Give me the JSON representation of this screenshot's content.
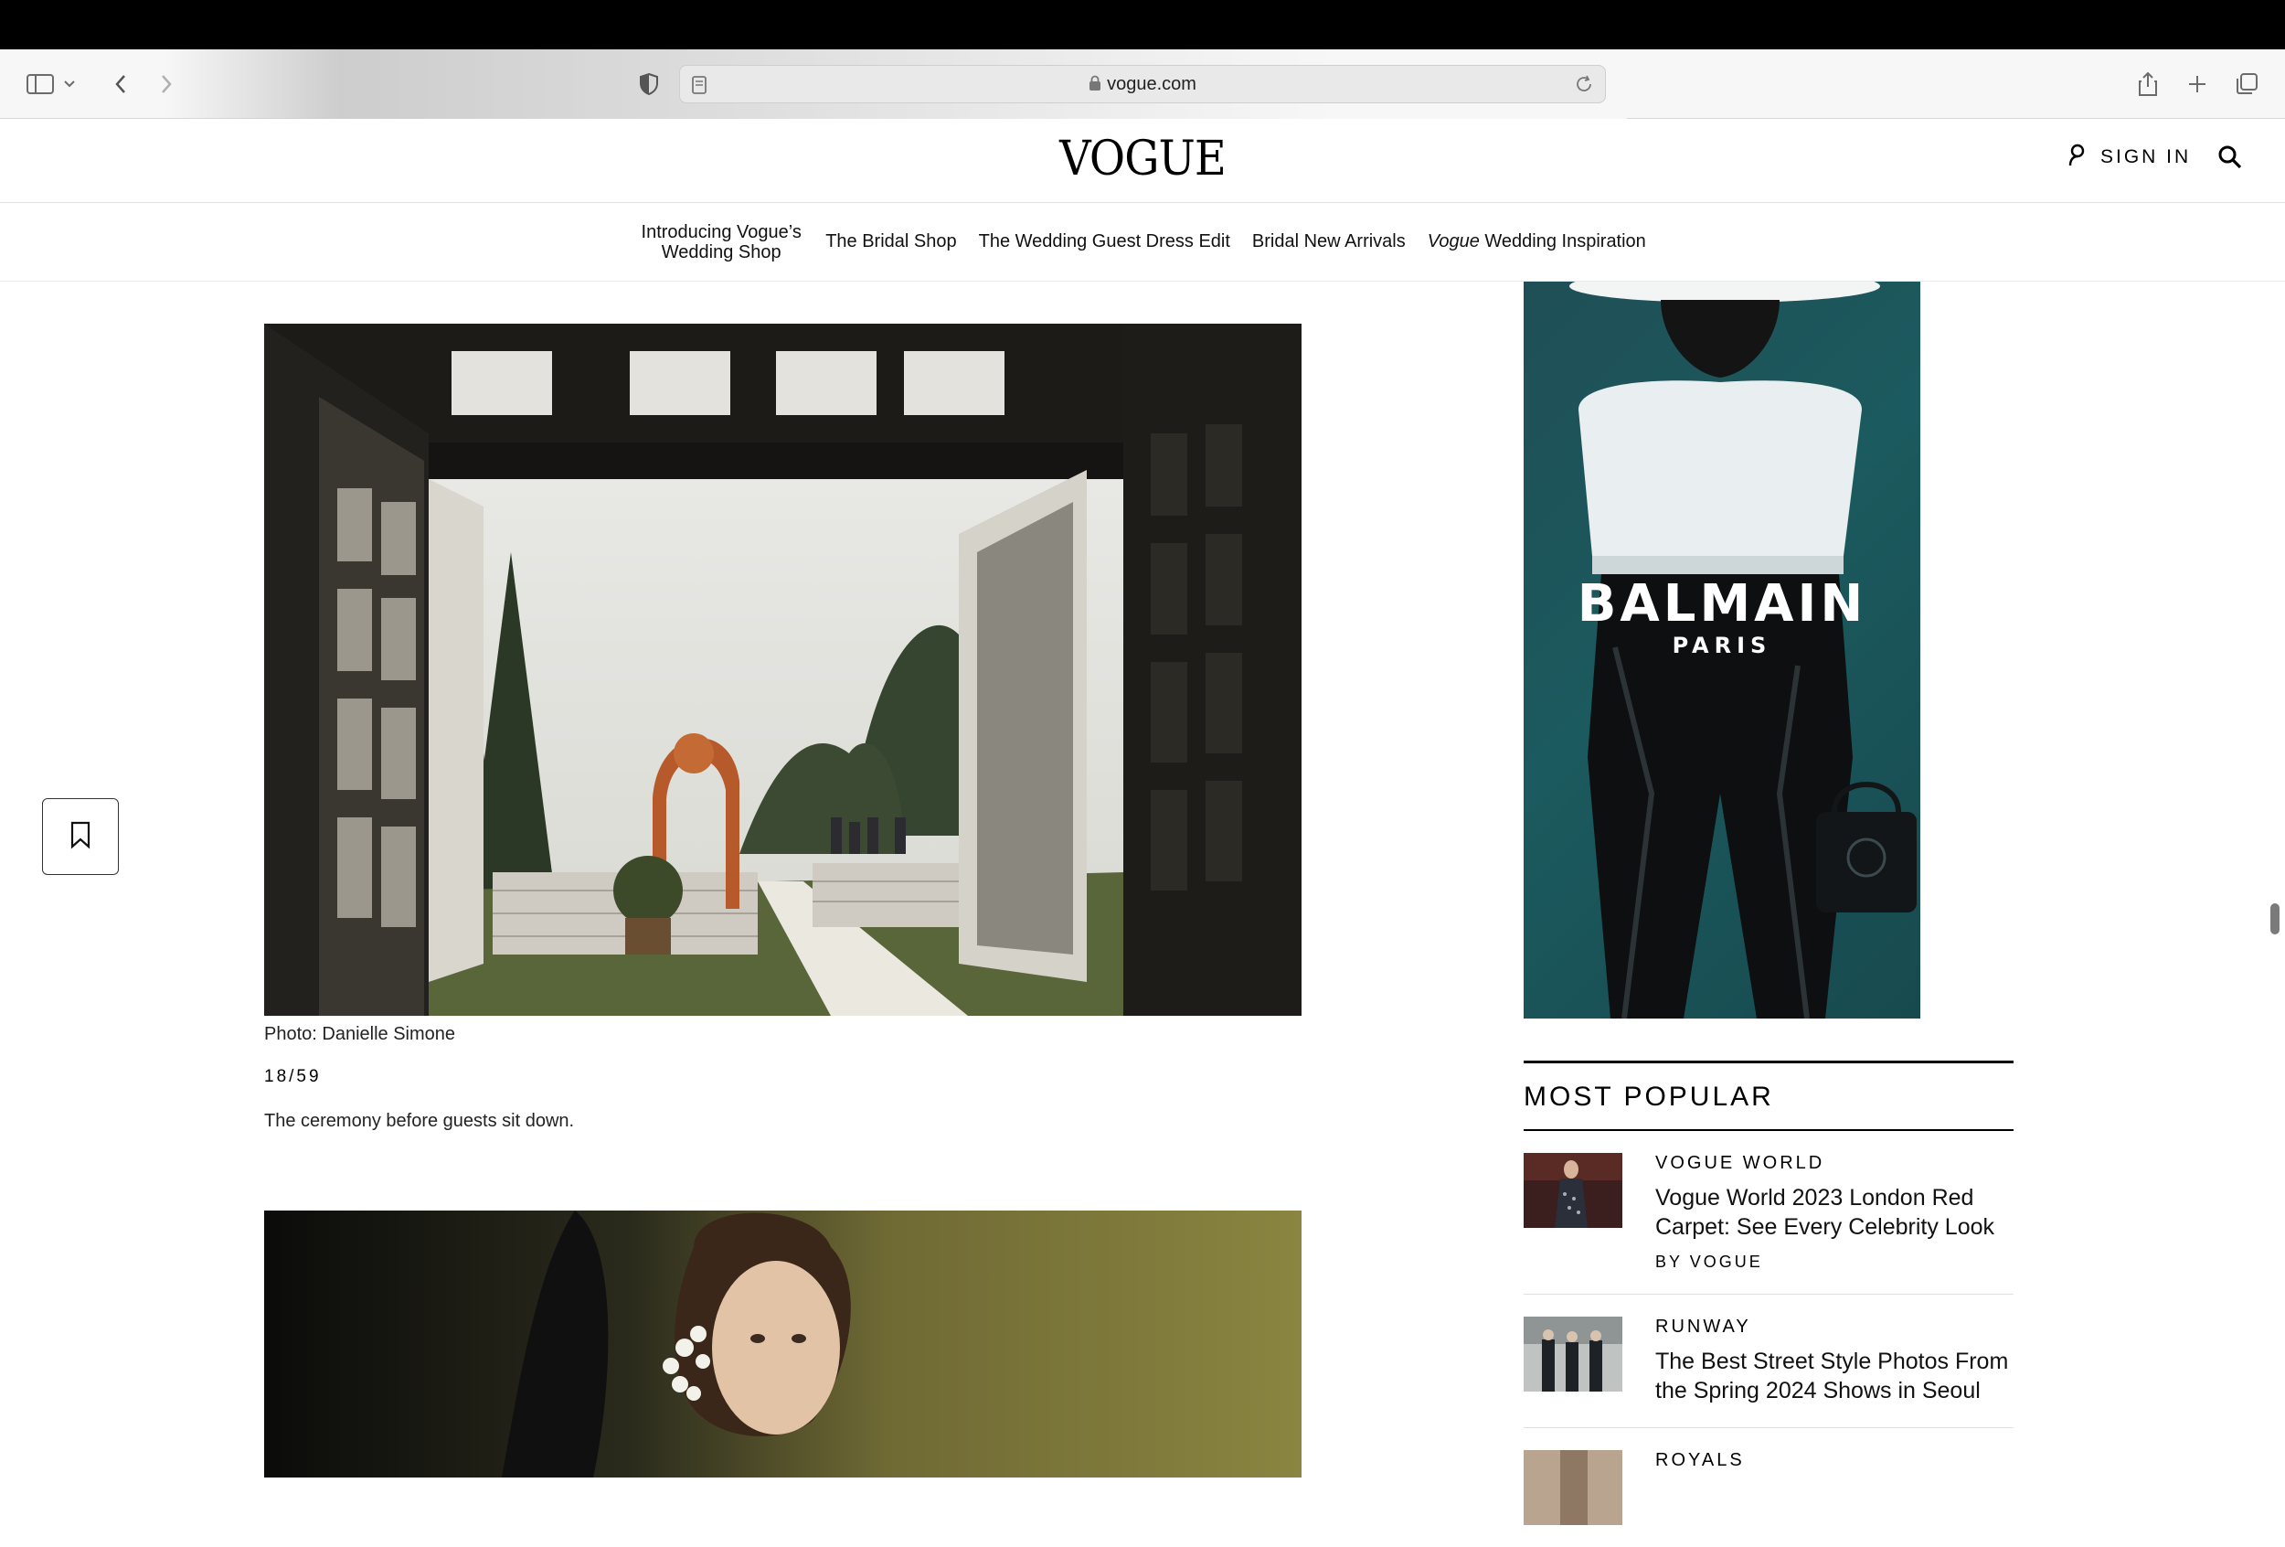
{
  "browser": {
    "url": "vogue.com"
  },
  "site": {
    "logo": "VOGUE",
    "sign_in": "SIGN IN"
  },
  "nav": {
    "items": [
      "Introducing Vogue’s Wedding Shop",
      "The Bridal Shop",
      "The Wedding Guest Dress Edit",
      "Bridal New Arrivals"
    ],
    "last_item_em": "Vogue",
    "last_item_rest": " Wedding Inspiration"
  },
  "gallery": {
    "credit": "Photo: Danielle Simone",
    "counter": "18/59",
    "caption": "The ceremony before guests sit down."
  },
  "ad": {
    "brand": "BALMAIN",
    "sub": "PARIS"
  },
  "most_popular": {
    "title": "MOST POPULAR",
    "items": [
      {
        "category": "VOGUE WORLD",
        "headline": "Vogue World 2023 London Red Carpet: See Every Celebrity Look",
        "byline": "BY VOGUE"
      },
      {
        "category": "RUNWAY",
        "headline": "The Best Street Style Photos From the Spring 2024 Shows in Seoul"
      },
      {
        "category": "ROYALS"
      }
    ]
  }
}
